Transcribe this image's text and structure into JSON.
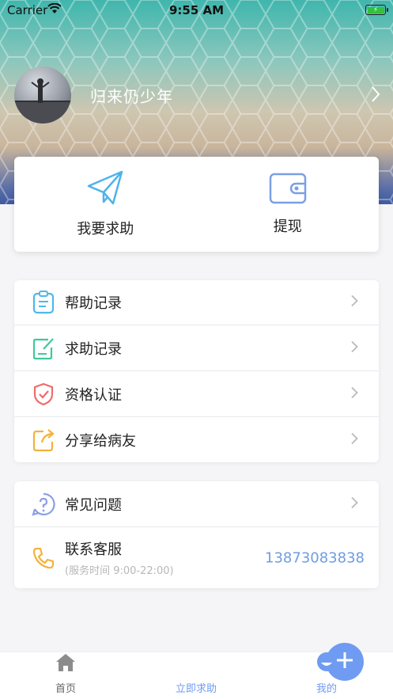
{
  "status_bar": {
    "carrier": "Carrier",
    "time": "9:55 AM"
  },
  "profile": {
    "username": "归来仍少年"
  },
  "quick_actions": [
    {
      "label": "我要求助",
      "icon": "paper-plane-icon"
    },
    {
      "label": "提现",
      "icon": "wallet-icon"
    }
  ],
  "menu1": [
    {
      "label": "帮助记录",
      "icon": "clipboard-icon",
      "color": "#4fb8e8"
    },
    {
      "label": "求助记录",
      "icon": "edit-note-icon",
      "color": "#3ec99a"
    },
    {
      "label": "资格认证",
      "icon": "shield-check-icon",
      "color": "#ef6b6b"
    },
    {
      "label": "分享给病友",
      "icon": "share-icon",
      "color": "#f2b23c"
    }
  ],
  "menu2": {
    "faq": {
      "label": "常见问题",
      "icon": "question-icon"
    },
    "contact": {
      "label": "联系客服",
      "sub": "(服务时间 9:00-22:00)",
      "phone": "13873083838",
      "icon": "phone-icon"
    }
  },
  "tabbar": {
    "home": "首页",
    "help_now": "立即求助",
    "mine": "我的",
    "active_color": "#6f9bf2"
  }
}
